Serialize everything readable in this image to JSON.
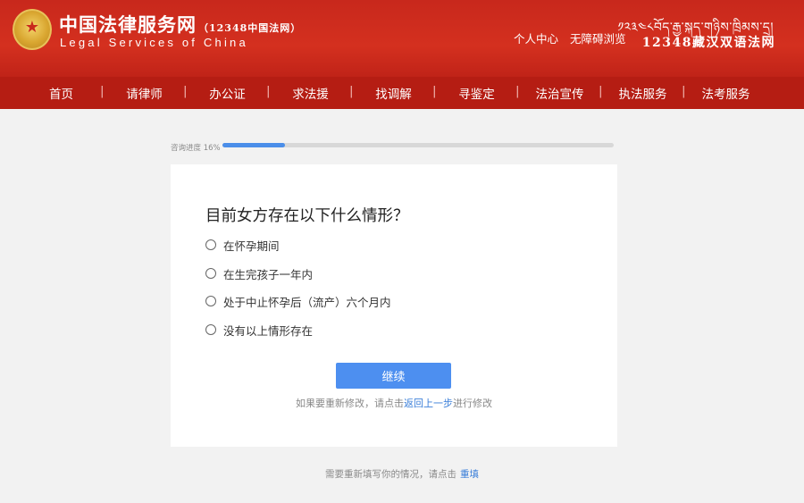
{
  "header": {
    "site_name_cn": "中国法律服务网",
    "site_name_tag": "（12348中国法网）",
    "site_name_en": "Legal Services of China",
    "links": [
      "个人中心",
      "无障碍浏览"
    ],
    "tibetan_title": "༡༢༣༤༨བོད་རྒྱ་སྐད་གཉིས་ཁྲིམས་དྲ།",
    "bilingual_title": "12348藏汉双语法网"
  },
  "nav": {
    "items": [
      "首页",
      "请律师",
      "办公证",
      "求法援",
      "找调解",
      "寻鉴定",
      "法治宣传",
      "执法服务",
      "法考服务"
    ]
  },
  "progress": {
    "label": "咨询进度 16%",
    "percent": 16
  },
  "question": {
    "title": "目前女方存在以下什么情形？",
    "options": [
      "在怀孕期间",
      "在生完孩子一年内",
      "处于中止怀孕后（流产）六个月内",
      "没有以上情形存在"
    ]
  },
  "actions": {
    "continue_label": "继续",
    "hint_prefix": "如果要重新修改，请点击",
    "hint_link": "返回上一步",
    "hint_suffix": "进行修改"
  },
  "footer": {
    "text": "需要重新填写你的情况，请点击",
    "link": "重填"
  },
  "colors": {
    "header_red": "#d4301f",
    "nav_red": "#b51d13",
    "accent_blue": "#4d8ff0",
    "page_bg": "#f2f2f2"
  }
}
